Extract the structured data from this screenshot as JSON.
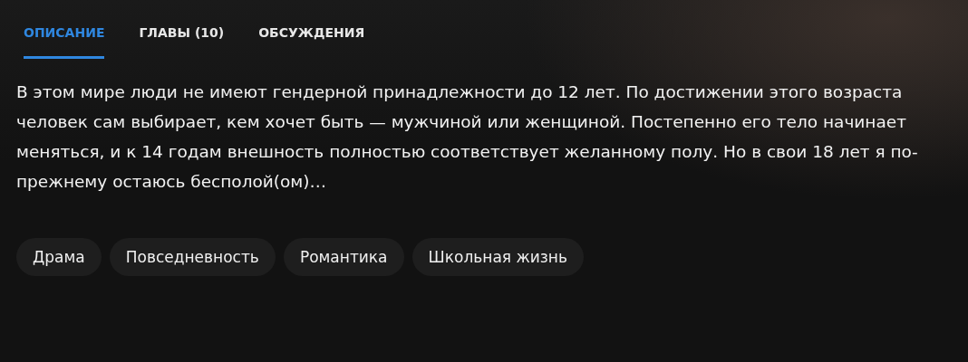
{
  "tabs": [
    {
      "label": "ОПИСАНИЕ",
      "selected": true
    },
    {
      "label": "ГЛАВЫ (10)",
      "selected": false
    },
    {
      "label": "ОБСУЖДЕНИЯ",
      "selected": false
    }
  ],
  "description": "В этом мире люди не имеют гендерной принадлежности до 12 лет. По достижении этого возраста человек сам выбирает, кем хочет быть — мужчиной или женщиной. Постепенно его тело начинает меняться, и к 14 годам внешность полностью соответствует желанному полу. Но в свои 18 лет я по-прежнему остаюсь бесполой(ом)…",
  "tags": [
    "Драма",
    "Повседневность",
    "Романтика",
    "Школьная жизнь"
  ]
}
